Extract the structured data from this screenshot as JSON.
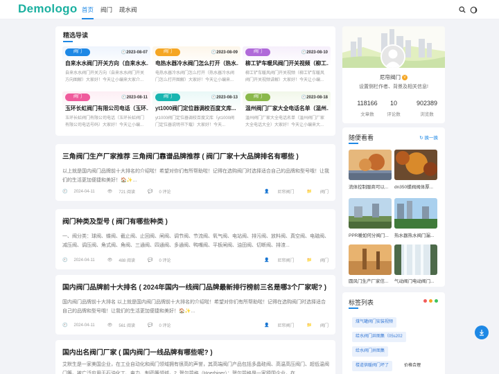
{
  "header": {
    "logo": "Demologo",
    "nav": [
      {
        "label": "首页",
        "active": true
      },
      {
        "label": "阀门",
        "active": false
      },
      {
        "label": "疏水阀",
        "active": false
      }
    ]
  },
  "guide": {
    "title": "精选导读",
    "items": [
      {
        "tag": "阀门",
        "tag_color": "#1e88e5",
        "date": "2023-08-07",
        "title": "自来水水阀门开关方向（自来水水...",
        "desc": "自来水水阀门开关方向（自来水水阀门开关方向图解）大家好！今天让小编来大家介..."
      },
      {
        "tag": "阀门",
        "tag_color": "#f5a623",
        "date": "2023-08-09",
        "title": "电热水器冷水阀门怎么打开（热水...",
        "desc": "电热水器冷水阀门怎么打开（热水器冷水阀门怎么打开图解）大家好！今天让小编来..."
      },
      {
        "tag": "阀门",
        "tag_color": "#b06ad9",
        "date": "2023-08-10",
        "title": "柳工铲车暖风阀门开关视频（柳工...",
        "desc": "柳工铲车暖风阀门开关视频（柳工铲车暖风阀门开关视频讲解）大家好！今天让小编..."
      },
      {
        "tag": "阀门",
        "tag_color": "#ef5b9c",
        "date": "2023-08-11",
        "title": "玉环长虹阀门有限公司电话（玉环...",
        "desc": "玉环长虹阀门有限公司电话（玉环长虹阀门有限公司电话号码）大家好！今天让小编..."
      },
      {
        "tag": "阀门",
        "tag_color": "#19b5b0",
        "date": "2023-08-13",
        "title": "yt1000阀门定位器调校百度文库...",
        "desc": "yt1000阀门定位器调校百度文库（yt1000阀门定位器说明书下载）大家好！今天..."
      },
      {
        "tag": "阀门",
        "tag_color": "#8ab84a",
        "date": "2023-08-18",
        "title": "温州阀门厂家大全电话名单（温州...",
        "desc": "温州阀门厂家大全电话名单（温州阀门厂家大全电话大全）大家好！今天让小编来大..."
      }
    ]
  },
  "articles": [
    {
      "title": "三角阀门生产厂家推荐 三角阀门靠谱品牌推荐 ( 阀门厂家十大品牌排名有哪些 )",
      "excerpt": "以上就是国内阀门品牌前十大排名的介绍啦！希望对你们有所帮助啦！记得在选购阀门时选择适合自己的品牌和型号哦！让我们的生活更加便捷和美好！🏠✨...",
      "date": "2024-04-11",
      "views": "721 阅读",
      "comments": "0 评论",
      "author": "尼帘阀门",
      "category": "阀门"
    },
    {
      "title": "阀门种类及型号 ( 阀门有哪些种类 )",
      "excerpt": "一、阀分类：球阀、蝶阀、截止阀、止回阀、闸阀、调节阀、节流阀、氧气阀、电站阀、排污阀、放料阀、真空阀、电磁阀、减压阀、调压阀、角式阀、角阀、三通阀、四通阀、多通阀、鸭嘴阀、平板闸阀、油田阀、切断阀、排渣...",
      "date": "2024-04-11",
      "views": "488 阅读",
      "comments": "0 评论",
      "author": "尼帘阀门",
      "category": "阀门"
    },
    {
      "title": "国内阀门品牌前十大排名 ( 2024年国内一线阀门品牌最新排行榜前三名是哪3个厂家呢? )",
      "excerpt": "国内阀门品牌前十大排名 以上就是国内阀门品牌前十大排名的介绍啦！希望对你们有所帮助啦！记得在选购阀门时选择适合自己的品牌和型号哦！让我们的生活更加便捷和美好！🏠✨...",
      "date": "2024-04-11",
      "views": "561 阅读",
      "comments": "0 评论",
      "author": "尼帘阀门",
      "category": "阀门"
    },
    {
      "title": "国内出名阀门厂家 ( 国内阀门一线品牌有哪些呢? )",
      "excerpt": "艾默生是一家美国企业，在工业自动化和阀门领域拥有很高的声誉，其高端阀门产品包括多晶硅阀、高温高压阀门、超低温阀门等。被广泛应用于石油化工、电力、制药等领域。2. 贺尔碧格（Hoerbiger）：贺尔碧格是一家德国企业，在..."
    }
  ],
  "profile": {
    "name": "尼帘阀门",
    "level": "V",
    "bio": "设置侧栏作者、背景及相关信息!",
    "stats": [
      {
        "value": "118166",
        "label": "文章数"
      },
      {
        "value": "10",
        "label": "评论数"
      },
      {
        "value": "902389",
        "label": "浏览数"
      }
    ]
  },
  "random": {
    "title": "随便看看",
    "refresh": "换一换",
    "items": [
      {
        "caption": "流体控制服商可以..."
      },
      {
        "caption": "dn350蝶阀阀体厚..."
      },
      {
        "caption": "PPR暖如何分阀门..."
      },
      {
        "caption": "热水器热水阀门漏..."
      },
      {
        "caption": "圆风门生产厂家信..."
      },
      {
        "caption": "气动阀门电动阀门..."
      }
    ]
  },
  "tags": {
    "title": "标签列表",
    "items": [
      "煤气罐阀门安装视频",
      "给水阀门井图集（05s202",
      "给水阀门井图集",
      "楼道供暖阀门坏了",
      "价格合理"
    ]
  }
}
